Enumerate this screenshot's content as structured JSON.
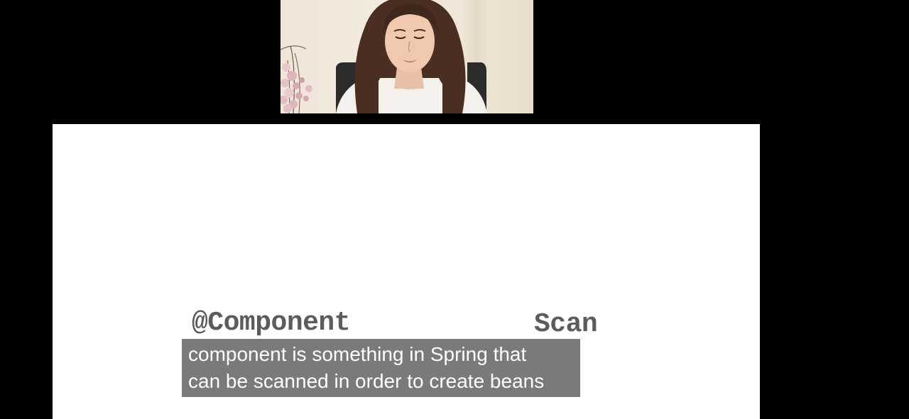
{
  "slide": {
    "code_left": "@Component",
    "code_right": "Scan"
  },
  "caption": {
    "lines": [
      "component is something in Spring that",
      "can be scanned in order to create beans"
    ]
  },
  "webcam": {
    "icon": "presenter-video-feed"
  },
  "colors": {
    "background": "#000000",
    "slide": "#ffffff",
    "code_text": "#5c5c5c",
    "caption_bg": "#767676",
    "caption_text": "#ffffff"
  }
}
